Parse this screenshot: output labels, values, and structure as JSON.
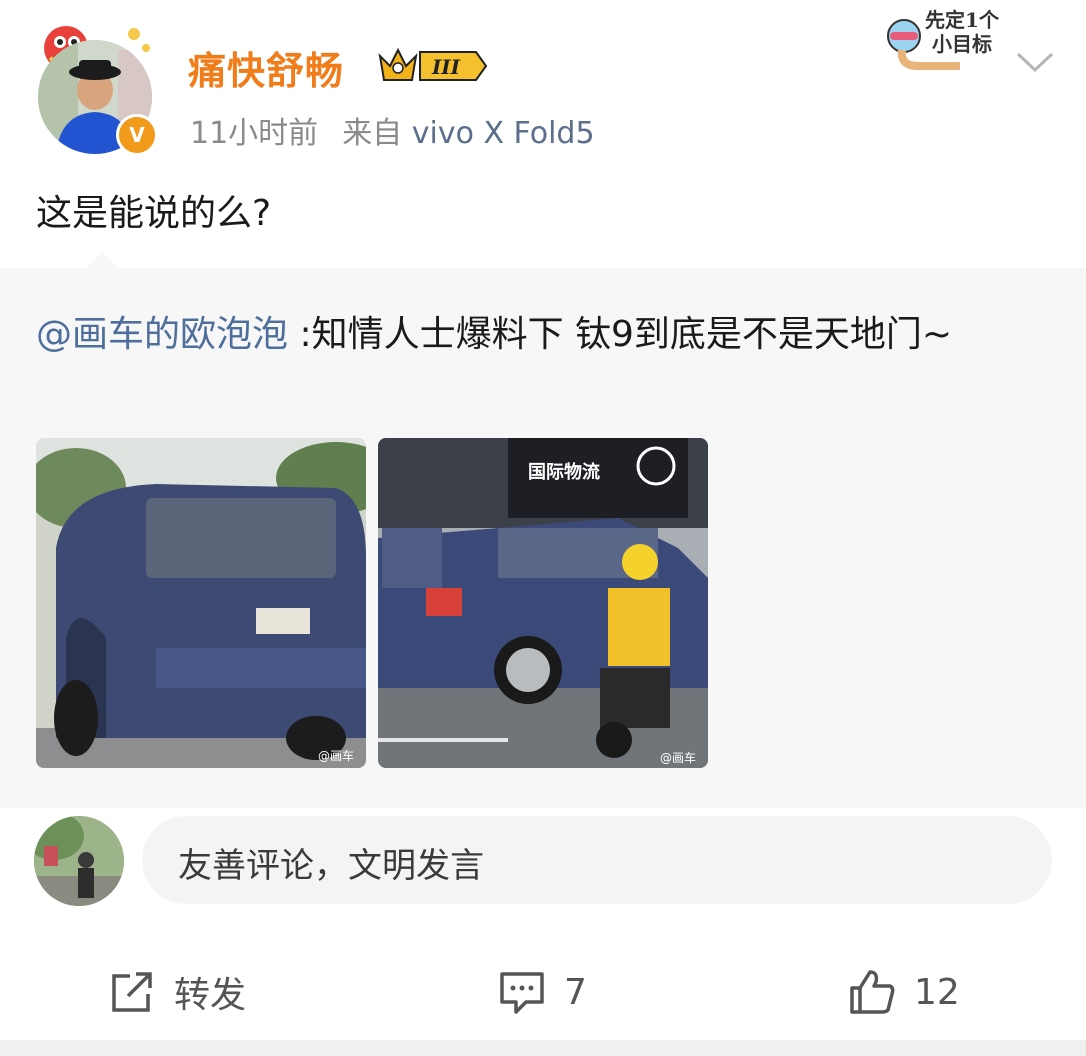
{
  "post": {
    "author": {
      "name": "痛快舒畅",
      "member_level": "III",
      "verified_mark": "V"
    },
    "time": "11小时前",
    "source_prefix": "来自",
    "device": "vivo X Fold5",
    "sticker_text": "先定1个小目标",
    "text": "这是能说的么?"
  },
  "repost": {
    "mention": "@画车的欧泡泡",
    "text": " :知情人士爆料下 钛9到底是不是天地门~",
    "images": [
      {
        "icon": "photo-suv-rear",
        "watermark": "@画车"
      },
      {
        "icon": "photo-suv-side",
        "watermark": "@画车",
        "truck_sign": "国际物流"
      }
    ]
  },
  "comment_box": {
    "placeholder": "友善评论，文明发言"
  },
  "actions": {
    "repost_label": "转发",
    "comment_count": "7",
    "like_count": "12"
  },
  "colors": {
    "username": "#f07c1a",
    "mention": "#4e6f9c",
    "repost_bg": "#f7f7f7",
    "badge": "#f29a1b"
  }
}
